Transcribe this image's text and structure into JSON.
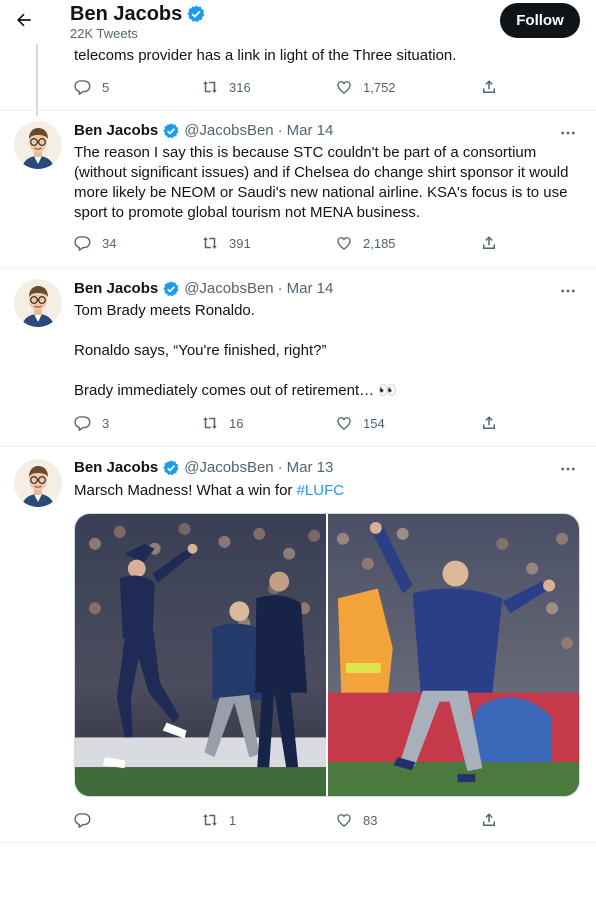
{
  "header": {
    "name": "Ben Jacobs",
    "tweet_count": "22K Tweets",
    "follow_label": "Follow"
  },
  "thread_tail": {
    "text": "telecoms provider has a link in light of the Three situation.",
    "replies": "5",
    "retweets": "316",
    "likes": "1,752"
  },
  "tweets": [
    {
      "name": "Ben Jacobs",
      "handle": "@JacobsBen",
      "dot": "·",
      "date": "Mar 14",
      "lines": [
        "The reason I say this is because STC couldn't be part of a consortium",
        "(without significant issues) and if Chelsea do change shirt sponsor it would",
        "more likely be NEOM or Saudi's new national airline. KSA's focus is to use",
        "sport to promote global tourism not MENA business."
      ],
      "replies": "34",
      "retweets": "391",
      "likes": "2,185"
    },
    {
      "name": "Ben Jacobs",
      "handle": "@JacobsBen",
      "dot": "·",
      "date": "Mar 14",
      "lines": [
        "Tom Brady meets Ronaldo.",
        "Ronaldo says, “You're finished, right?”",
        "Brady immediately comes out of retirement… 👀"
      ],
      "replies": "3",
      "retweets": "16",
      "likes": "154"
    },
    {
      "name": "Ben Jacobs",
      "handle": "@JacobsBen",
      "dot": "·",
      "date": "Mar 13",
      "text_plain": "Marsch Madness! What a win for ",
      "hashtag": "#LUFC",
      "replies": "",
      "retweets": "1",
      "likes": "83"
    }
  ],
  "colors": {
    "accent": "#1d9bf0",
    "text": "#0f1419",
    "muted": "#536471",
    "follow_bg": "#0f1419"
  }
}
